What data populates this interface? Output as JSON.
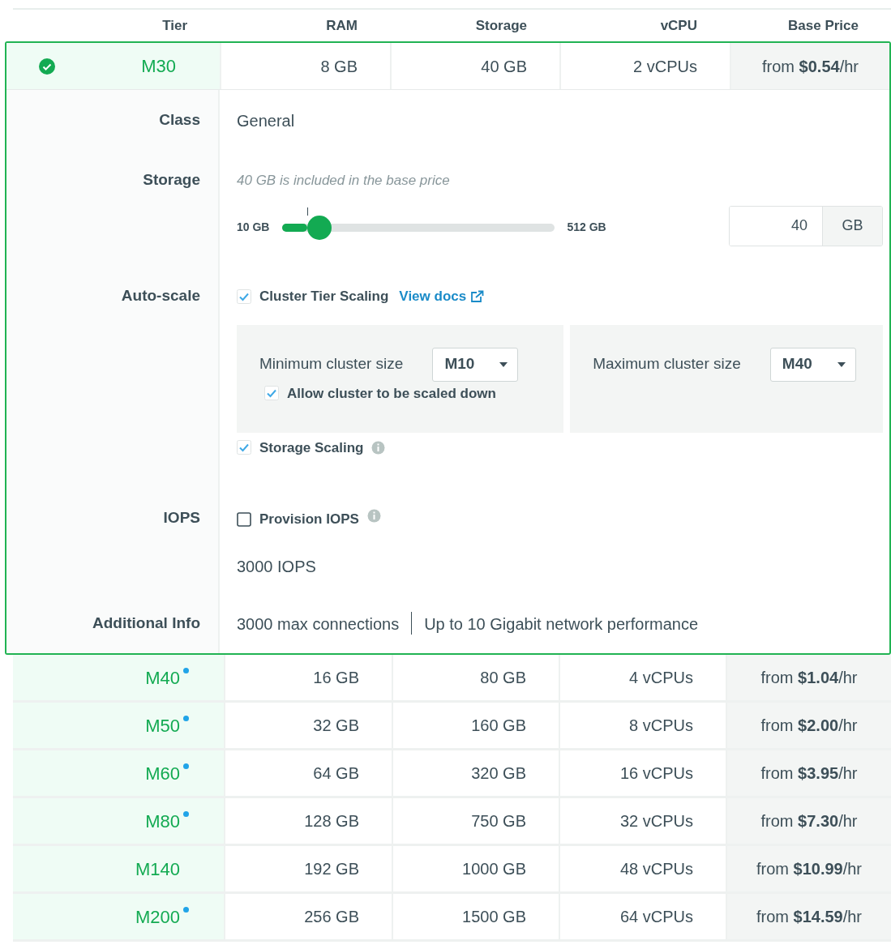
{
  "columns": [
    "Tier",
    "RAM",
    "Storage",
    "vCPU",
    "Base Price"
  ],
  "tiers": [
    {
      "tier": "M30",
      "selected": true,
      "new_dot": false,
      "ram": "8 GB",
      "storage": "40 GB",
      "vcpu": "2 vCPUs",
      "price": "from **$0.54**/hr",
      "details": {
        "class": {
          "label": "Class",
          "value": "General"
        },
        "storage": {
          "label": "Storage",
          "note": "40 GB is included in the base price",
          "min_label": "10 GB",
          "max_label": "512 GB",
          "level": 0.09,
          "value": "40",
          "unit": "GB"
        },
        "auto_scale": {
          "label": "Auto-scale",
          "cluster_tier_scaling": {
            "label": "Cluster Tier Scaling",
            "checked": true,
            "link": "View docs"
          },
          "minimum": {
            "label": "Minimum cluster size",
            "value": "M10"
          },
          "allow_scale_down": {
            "label": "Allow cluster to be scaled down",
            "checked": true
          },
          "maximum": {
            "label": "Maximum cluster size",
            "value": "M40"
          },
          "storage_scaling": {
            "label": "Storage Scaling",
            "checked": true
          }
        },
        "iops": {
          "label": "IOPS",
          "provision": {
            "label": "Provision IOPS",
            "checked": false
          },
          "value": "3000 IOPS"
        },
        "additional_info": {
          "label": "Additional Info",
          "items": [
            "3000 max connections",
            "Up to 10 Gigabit network performance"
          ]
        }
      }
    },
    {
      "tier": "M40",
      "selected": false,
      "new_dot": true,
      "ram": "16 GB",
      "storage": "80 GB",
      "vcpu": "4 vCPUs",
      "price": "from **$1.04**/hr"
    },
    {
      "tier": "M50",
      "selected": false,
      "new_dot": true,
      "ram": "32 GB",
      "storage": "160 GB",
      "vcpu": "8 vCPUs",
      "price": "from **$2.00**/hr"
    },
    {
      "tier": "M60",
      "selected": false,
      "new_dot": true,
      "ram": "64 GB",
      "storage": "320 GB",
      "vcpu": "16 vCPUs",
      "price": "from **$3.95**/hr"
    },
    {
      "tier": "M80",
      "selected": false,
      "new_dot": true,
      "ram": "128 GB",
      "storage": "750 GB",
      "vcpu": "32 vCPUs",
      "price": "from **$7.30**/hr"
    },
    {
      "tier": "M140",
      "selected": false,
      "new_dot": false,
      "ram": "192 GB",
      "storage": "1000 GB",
      "vcpu": "48 vCPUs",
      "price": "from **$10.99**/hr"
    },
    {
      "tier": "M200",
      "selected": false,
      "new_dot": true,
      "ram": "256 GB",
      "storage": "1500 GB",
      "vcpu": "64 vCPUs",
      "price": "from **$14.59**/hr"
    }
  ]
}
